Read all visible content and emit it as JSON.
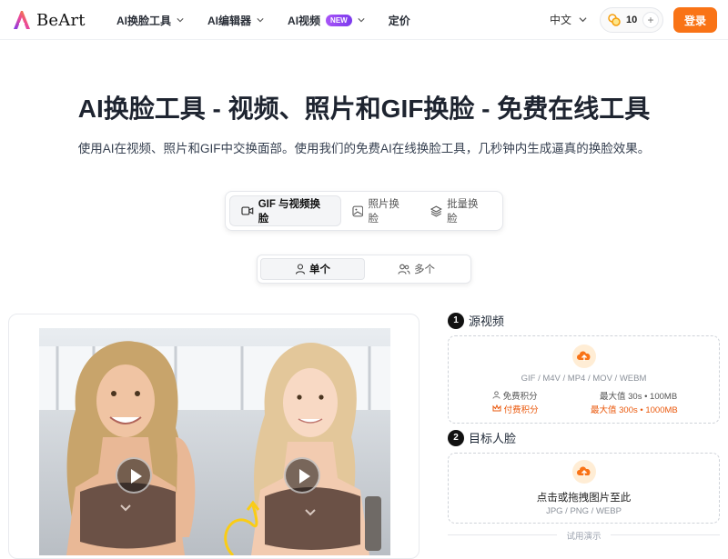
{
  "brand": {
    "name": "BeArt"
  },
  "nav": {
    "items": [
      {
        "label": "AI换脸工具",
        "has_dropdown": true
      },
      {
        "label": "AI编辑器",
        "has_dropdown": true
      },
      {
        "label": "AI视频",
        "badge": "NEW",
        "has_dropdown": true
      },
      {
        "label": "定价",
        "has_dropdown": false
      }
    ]
  },
  "header": {
    "language": "中文",
    "credits": "10",
    "credits_plus": "+",
    "login": "登录"
  },
  "hero": {
    "title": "AI换脸工具 - 视频、照片和GIF换脸 - 免费在线工具",
    "subtitle": "使用AI在视频、照片和GIF中交换面部。使用我们的免费AI在线换脸工具，几秒钟内生成逼真的换脸效果。"
  },
  "mode_tabs": [
    {
      "label": "GIF 与视频换脸",
      "icon": "video-icon",
      "active": true
    },
    {
      "label": "照片换脸",
      "icon": "image-icon",
      "active": false
    },
    {
      "label": "批量换脸",
      "icon": "layers-icon",
      "active": false
    }
  ],
  "face_toggle": [
    {
      "label": "单个",
      "icon": "user-icon",
      "active": true
    },
    {
      "label": "多个",
      "icon": "users-icon",
      "active": false
    }
  ],
  "step1": {
    "num": "1",
    "label": "源视频",
    "formats": "GIF / M4V / MP4 / MOV / WEBM",
    "free_label": "免费积分",
    "free_limit": "最大值 30s • 100MB",
    "paid_label": "付费积分",
    "paid_limit": "最大值 300s • 1000MB"
  },
  "step2": {
    "num": "2",
    "label": "目标人脸",
    "prompt": "点击或拖拽图片至此",
    "formats": "JPG / PNG / WEBP"
  },
  "trial": "试用演示",
  "colors": {
    "accent": "#f97316",
    "badge": "#8b5cf6",
    "paid": "#ea580c"
  }
}
